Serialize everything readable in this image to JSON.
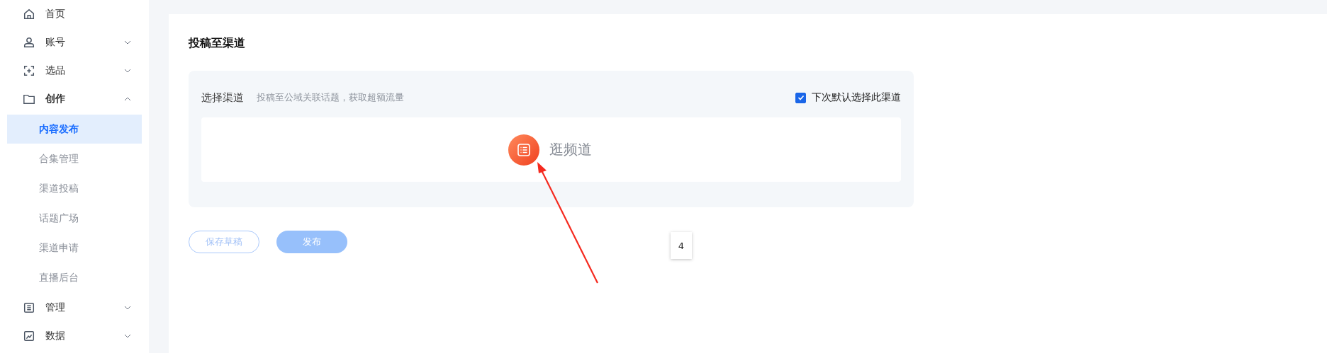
{
  "sidebar": {
    "items": [
      {
        "label": "首页"
      },
      {
        "label": "账号",
        "expanded": false
      },
      {
        "label": "选品",
        "expanded": false
      },
      {
        "label": "创作",
        "expanded": true,
        "children": [
          {
            "label": "内容发布",
            "selected": true
          },
          {
            "label": "合集管理",
            "selected": false
          },
          {
            "label": "渠道投稿",
            "selected": false
          },
          {
            "label": "话题广场",
            "selected": false
          },
          {
            "label": "渠道申请",
            "selected": false
          },
          {
            "label": "直播后台",
            "selected": false
          }
        ]
      },
      {
        "label": "管理",
        "expanded": false
      },
      {
        "label": "数据",
        "expanded": false
      }
    ]
  },
  "section": {
    "title": "投稿至渠道",
    "channel_panel": {
      "label": "选择渠道",
      "hint": "投稿至公域关联话题，获取超额流量",
      "default_checkbox": {
        "label": "下次默认选择此渠道",
        "checked": true
      },
      "channel": {
        "name": "逛频道"
      }
    }
  },
  "buttons": [
    {
      "label": "保存草稿",
      "kind": "outline",
      "disabled": true
    },
    {
      "label": "发布",
      "kind": "primary",
      "disabled": true
    }
  ],
  "badge": "4"
}
